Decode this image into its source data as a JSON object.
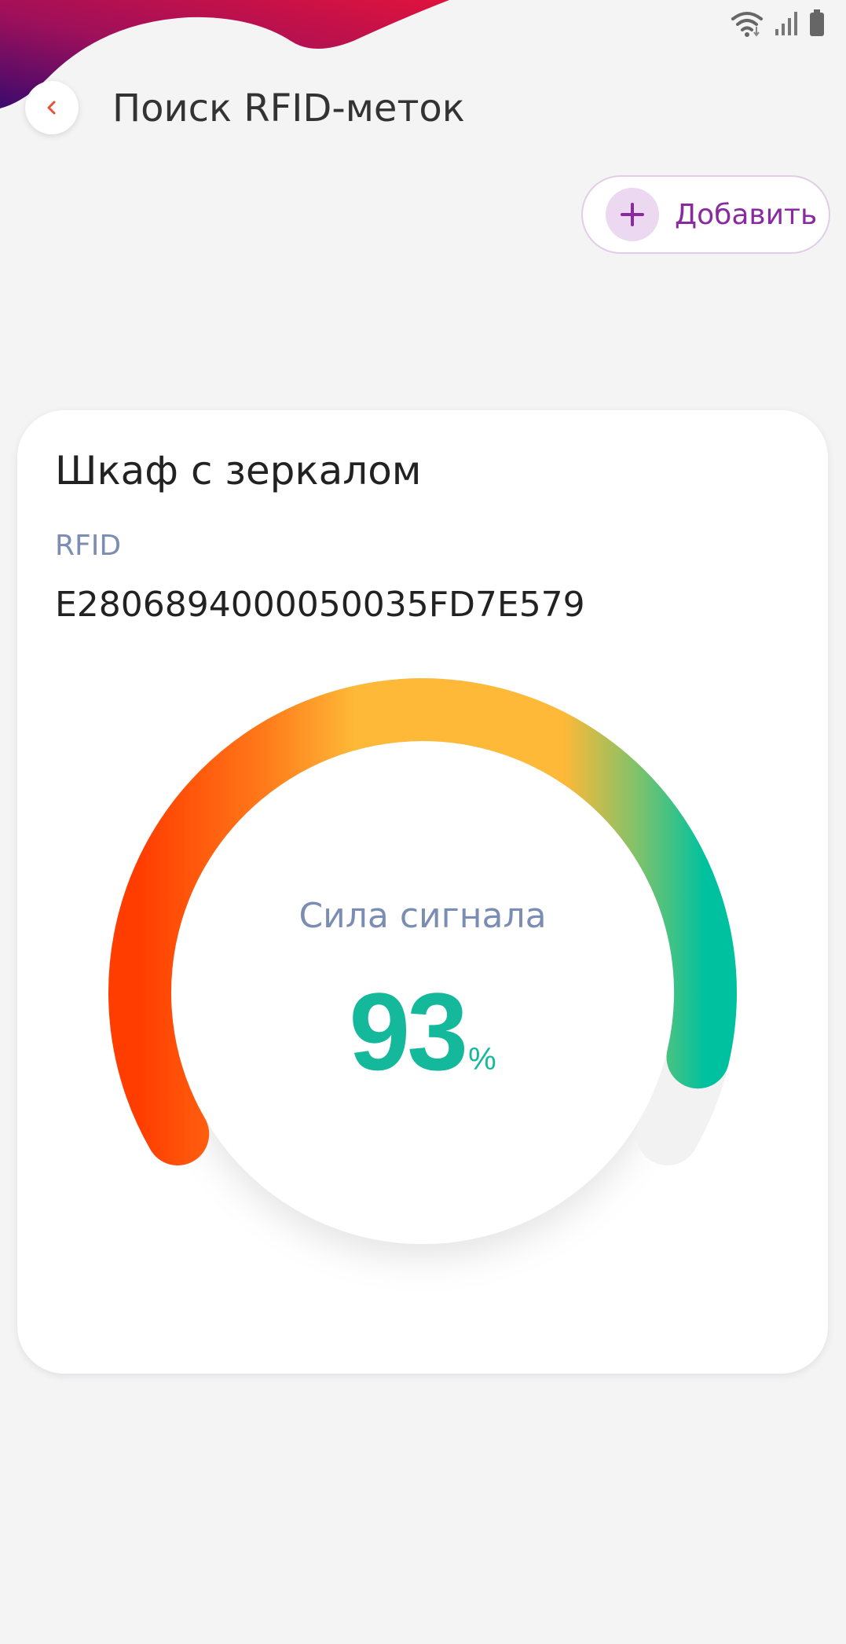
{
  "colors": {
    "background": "#f4f4f5",
    "accent": "#8a2aa0",
    "signal_good": "#13b99a",
    "gauge_start": "#ff3d00",
    "gauge_mid": "#fdb937",
    "gauge_end": "#00c19f",
    "header_blob_start": "#3c0a6e",
    "header_blob_end": "#e0123c"
  },
  "status_bar": {
    "icons": [
      "wifi-icon",
      "cellular-signal-icon",
      "battery-icon"
    ]
  },
  "header": {
    "back_icon": "chevron-left-icon",
    "title": "Поиск RFID-меток"
  },
  "actions": {
    "add_label": "Добавить",
    "add_icon": "plus-icon"
  },
  "item": {
    "name": "Шкаф с зеркалом",
    "rfid_label": "RFID",
    "rfid_value": "E2806894000050035FD7E579"
  },
  "signal": {
    "caption": "Сила сигнала",
    "value": "93",
    "unit": "%",
    "level": 0.93
  }
}
